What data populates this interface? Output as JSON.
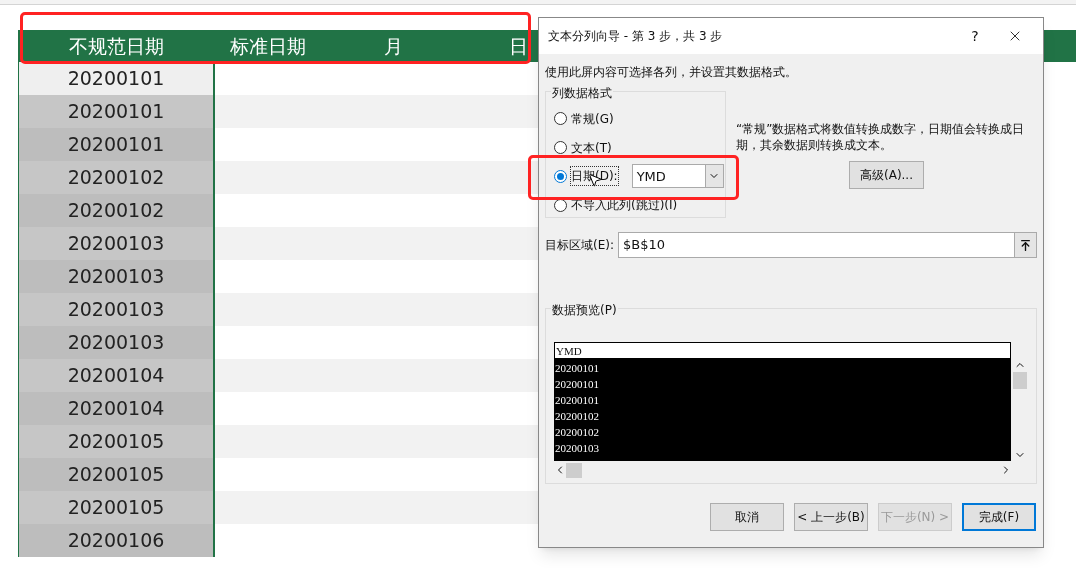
{
  "sheet": {
    "headers": [
      "不规范日期",
      "标准日期",
      "月",
      "日"
    ],
    "rows": [
      {
        "value": "20200101",
        "active": true
      },
      {
        "value": "20200101",
        "active": false
      },
      {
        "value": "20200101",
        "active": false
      },
      {
        "value": "20200102",
        "active": false
      },
      {
        "value": "20200102",
        "active": false
      },
      {
        "value": "20200103",
        "active": false
      },
      {
        "value": "20200103",
        "active": false
      },
      {
        "value": "20200103",
        "active": false
      },
      {
        "value": "20200103",
        "active": false
      },
      {
        "value": "20200104",
        "active": false
      },
      {
        "value": "20200104",
        "active": false
      },
      {
        "value": "20200105",
        "active": false
      },
      {
        "value": "20200105",
        "active": false
      },
      {
        "value": "20200105",
        "active": false
      },
      {
        "value": "20200106",
        "active": false
      }
    ]
  },
  "dialog": {
    "title": "文本分列向导 - 第 3 步，共 3 步",
    "help": "?",
    "instruction": "使用此屏内容可选择各列，并设置其数据格式。",
    "format_group": {
      "legend": "列数据格式",
      "options": [
        {
          "label": "常规(G)",
          "selected": false,
          "kind": "plain"
        },
        {
          "label": "文本(T)",
          "selected": false,
          "kind": "plain"
        },
        {
          "label": "日期(D):",
          "selected": true,
          "kind": "date",
          "format": "YMD"
        },
        {
          "label": "不导入此列(跳过)(I)",
          "selected": false,
          "kind": "plain"
        }
      ]
    },
    "note": "“常规”数据格式将数值转换成数字，日期值会转换成日期，其余数据则转换成文本。",
    "advanced_button": "高级(A)...",
    "destination": {
      "label": "目标区域(E):",
      "value": "$B$10"
    },
    "preview": {
      "legend": "数据预览(P)",
      "header": "YMD",
      "rows": [
        "20200101",
        "20200101",
        "20200101",
        "20200102",
        "20200102",
        "20200103"
      ]
    },
    "buttons": [
      {
        "label": "取消",
        "disabled": false,
        "default": false
      },
      {
        "label": "< 上一步(B)",
        "disabled": false,
        "default": false
      },
      {
        "label": "下一步(N) >",
        "disabled": true,
        "default": false
      },
      {
        "label": "完成(F)",
        "disabled": false,
        "default": true
      }
    ]
  }
}
